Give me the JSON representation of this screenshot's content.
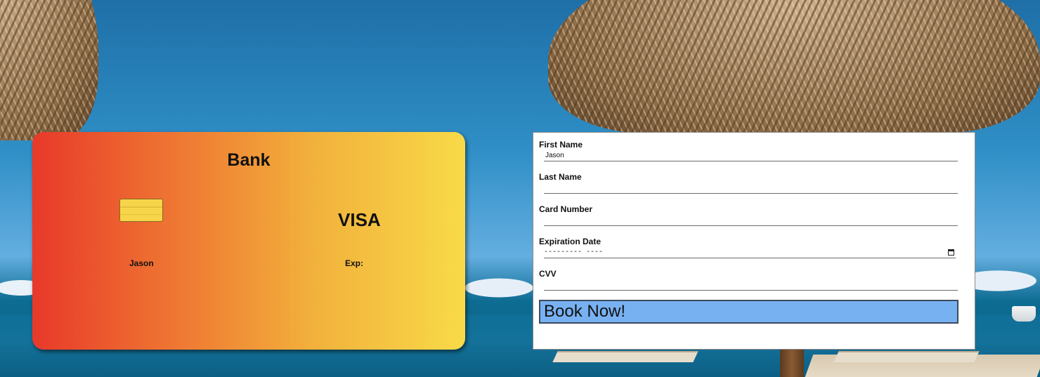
{
  "card": {
    "bank_name": "Bank",
    "network": "VISA",
    "holder_name": "Jason",
    "exp_label": "Exp:",
    "gradient_colors": [
      "#e8392a",
      "#f8da48"
    ]
  },
  "form": {
    "first_name": {
      "label": "First Name",
      "value": "Jason"
    },
    "last_name": {
      "label": "Last Name",
      "value": ""
    },
    "card_number": {
      "label": "Card Number",
      "value": ""
    },
    "expiration_date": {
      "label": "Expiration Date",
      "placeholder": "--------- ----"
    },
    "cvv": {
      "label": "CVV",
      "value": ""
    },
    "submit_label": "Book Now!",
    "submit_color": "#78b1f2"
  },
  "icons": {
    "chip": "card-chip-icon",
    "calendar": "calendar-icon"
  }
}
